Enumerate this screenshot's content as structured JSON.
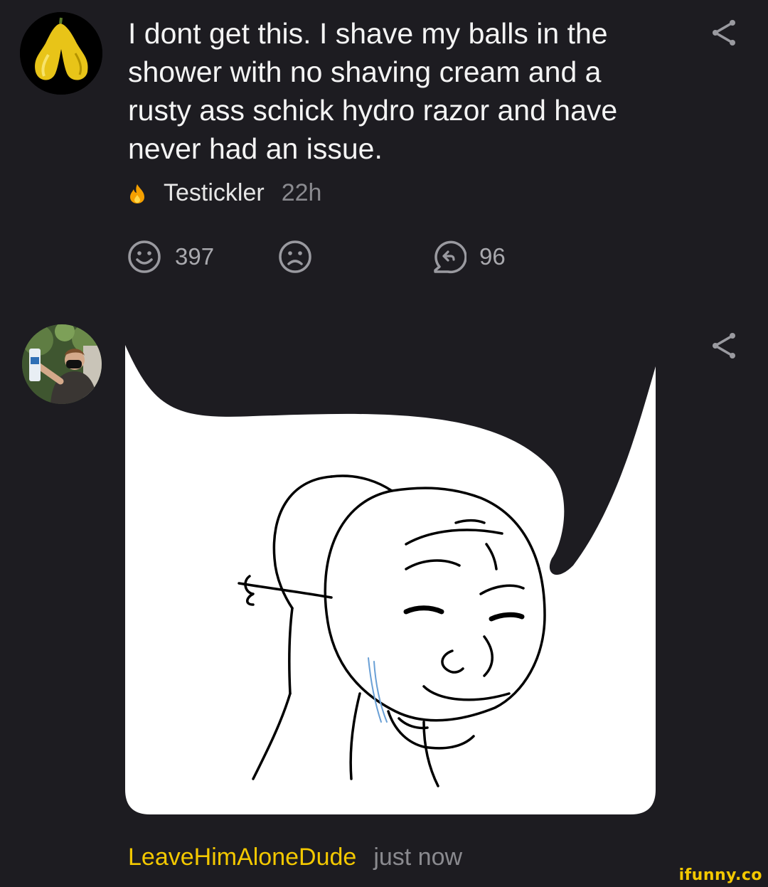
{
  "comments": [
    {
      "text": "I dont get this. I shave my balls in the shower with no shaving cream and a rusty ass schick hydro razor and have never had an issue.",
      "username": "Testickler",
      "time": "22h",
      "smile_count": "397",
      "reply_count": "96",
      "avatar_icon": "yellow-pepper-avatar",
      "badge_icon": "flame-icon"
    },
    {
      "username": "LeaveHimAloneDude",
      "time": "just now",
      "avatar_icon": "person-with-mask-avatar",
      "image": "wojak-speech-bubble-meme"
    }
  ],
  "watermark": "ifunny.co",
  "colors": {
    "background": "#1d1c21",
    "username_accent": "#f3c800",
    "muted": "#8a8a8f"
  }
}
